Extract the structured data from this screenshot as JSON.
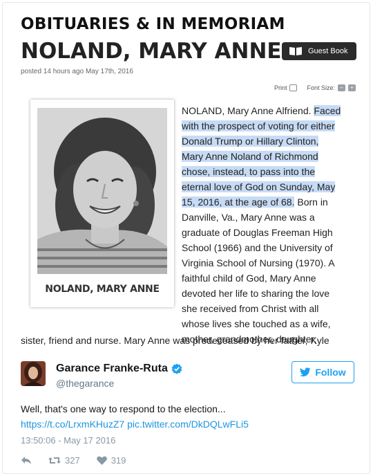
{
  "obituary": {
    "section_title": "OBITUARIES & IN MEMORIAM",
    "name_heading": "NOLAND, MARY ANNE",
    "guestbook_label": "Guest Book",
    "posted": "posted 14 hours ago May 17th, 2016",
    "print_label": "Print",
    "font_size_label": "Font Size:",
    "font_minus": "–",
    "font_plus": "+",
    "photo_caption": "NOLAND, MARY ANNE",
    "body_lines": [
      {
        "plain": "NOLAND, Mary Anne Alfriend. ",
        "highlight": "Faced",
        "tail": ""
      },
      {
        "plain": "",
        "highlight": "with the prospect of voting for either",
        "tail": ""
      },
      {
        "plain": "",
        "highlight": "Donald Trump or Hillary Clinton,",
        "tail": ""
      },
      {
        "plain": "",
        "highlight": "Mary Anne Noland of Richmond",
        "tail": ""
      },
      {
        "plain": "",
        "highlight": "chose, instead, to pass into the",
        "tail": ""
      },
      {
        "plain": "",
        "highlight": "eternal love of God on Sunday, May",
        "tail": ""
      },
      {
        "plain": "",
        "highlight": "15, 2016, at the age of 68.",
        "tail": " Born in"
      },
      {
        "plain": "Danville, Va., Mary Anne was a",
        "highlight": "",
        "tail": ""
      },
      {
        "plain": "graduate of Douglas Freeman High",
        "highlight": "",
        "tail": ""
      },
      {
        "plain": "School (1966) and the University of",
        "highlight": "",
        "tail": ""
      },
      {
        "plain": "Virginia School of Nursing (1970). A",
        "highlight": "",
        "tail": ""
      },
      {
        "plain": "faithful child of God, Mary Anne",
        "highlight": "",
        "tail": ""
      },
      {
        "plain": "devoted her life to sharing the love",
        "highlight": "",
        "tail": ""
      },
      {
        "plain": "she received from Christ with all",
        "highlight": "",
        "tail": ""
      },
      {
        "plain": "whose lives she touched as a wife,",
        "highlight": "",
        "tail": ""
      },
      {
        "plain": "mother, grandmother, daughter,",
        "highlight": "",
        "tail": ""
      }
    ],
    "last_line": "sister, friend and nurse. Mary Anne was predeceased by her father, Kyle",
    "highlight_color": "#c7dbf5"
  },
  "tweet": {
    "display_name": "Garance Franke-Ruta",
    "handle": "@thegarance",
    "follow_label": "Follow",
    "text": "Well, that's one way to respond to the election...",
    "link1": "https://t.co/LrxmKHuzZ7",
    "link2": "pic.twitter.com/DkDQLwFLi5",
    "timestamp": "13:50:06 - May 17 2016",
    "retweet_count": "327",
    "like_count": "319",
    "icons": {
      "reply": "reply-icon",
      "retweet": "retweet-icon",
      "like": "heart-icon",
      "verified": "verified-badge-icon",
      "follow": "twitter-bird-icon"
    },
    "colors": {
      "accent": "#1da1f2",
      "link": "#1b95e0",
      "muted": "#8899a6"
    }
  }
}
